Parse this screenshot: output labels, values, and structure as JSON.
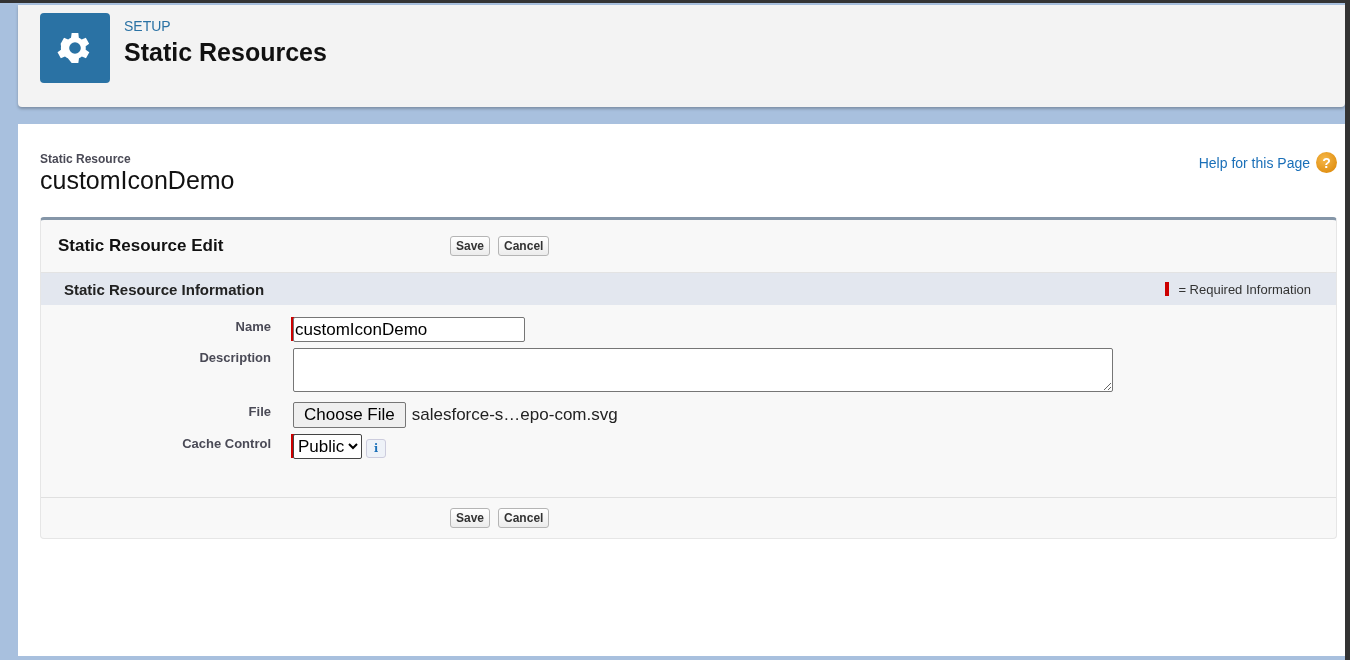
{
  "header": {
    "eyebrow": "SETUP",
    "title": "Static Resources"
  },
  "record": {
    "type_label": "Static Resource",
    "name": "customIconDemo",
    "help_link": "Help for this Page",
    "help_icon": "?"
  },
  "edit_block": {
    "title": "Static Resource Edit",
    "top_buttons": [
      "Save",
      "Cancel"
    ],
    "bottom_buttons": [
      "Save",
      "Cancel"
    ]
  },
  "section": {
    "title": "Static Resource Information",
    "required_legend": "= Required Information"
  },
  "fields": [
    {
      "kind": "text",
      "label": "Name",
      "required": true,
      "value": "customIconDemo"
    },
    {
      "kind": "textarea",
      "label": "Description",
      "required": false
    },
    {
      "kind": "file",
      "label": "File",
      "required": false,
      "button": "Choose File",
      "file_name": "salesforce-s…epo-com.svg"
    },
    {
      "kind": "select",
      "label": "Cache Control",
      "required": true,
      "value": "Public",
      "info_icon": "i"
    }
  ]
}
